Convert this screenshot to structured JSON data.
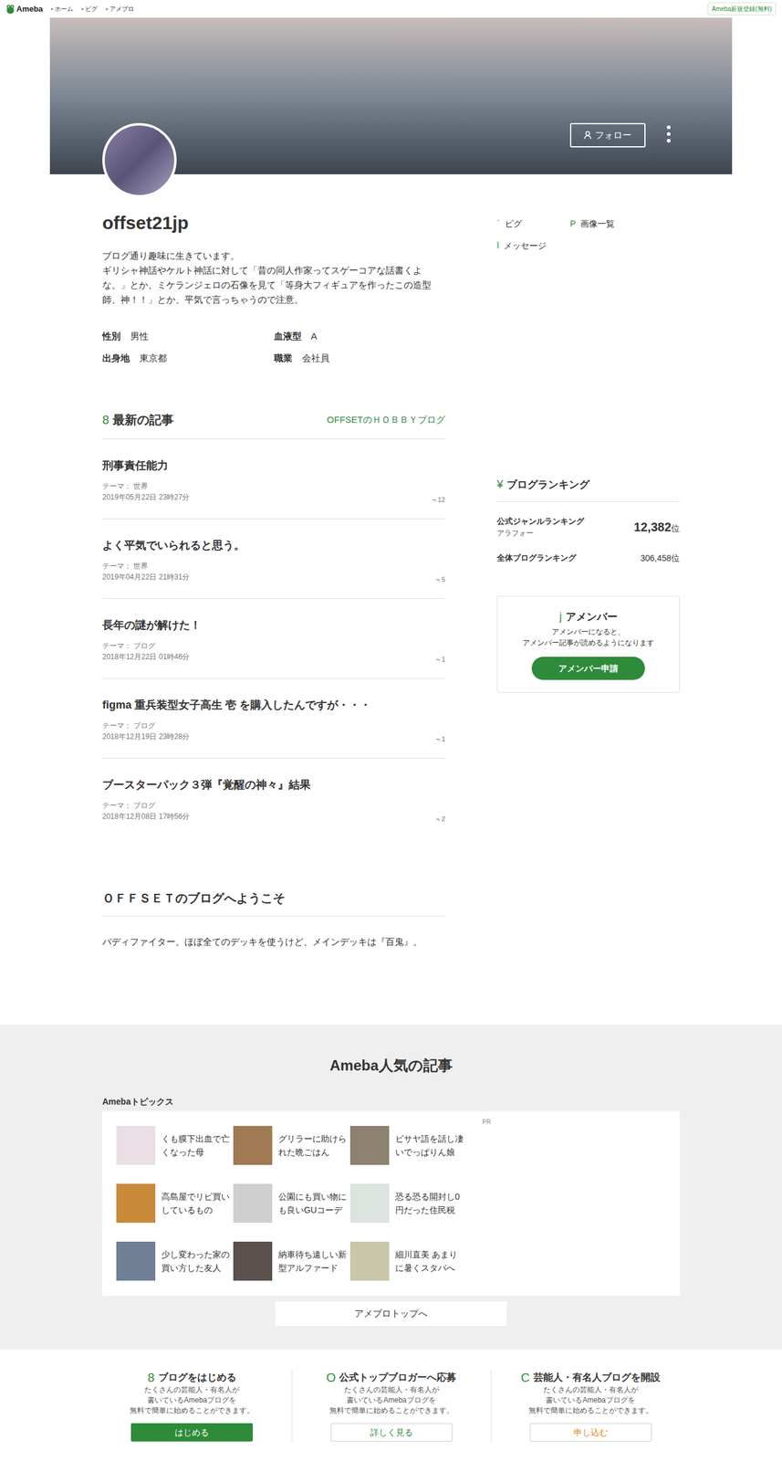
{
  "topbar": {
    "logo": "Ameba",
    "nav_marker": "▸",
    "nav": [
      "ホーム",
      "ピグ",
      "アメブロ"
    ],
    "register": "Ameba新規登録(無料)"
  },
  "header": {
    "follow": "フォロー"
  },
  "profile": {
    "name": "offset21jp",
    "bio": [
      "ブログ通り趣味に生きています。",
      "ギリシャ神話やケルト神話に対して「昔の同人作家ってスゲーコアな話書くよな。」とか、ミケランジェロの石像を見て「等身大フィギュアを作ったこの造型師、神！！」とか、平気で言っちゃうので注意。"
    ],
    "fields": [
      {
        "label": "性別",
        "value": "男性"
      },
      {
        "label": "血液型",
        "value": "A"
      },
      {
        "label": "出身地",
        "value": "東京都"
      },
      {
        "label": "職業",
        "value": "会社員"
      }
    ]
  },
  "latest": {
    "icon": "8",
    "title": "最新の記事",
    "blog_link": "OFFSETのＨＯＢＢＹブログ",
    "theme_label": "テーマ：",
    "comment_icon": "¬",
    "articles": [
      {
        "title": "刑事責任能力",
        "theme": "世界",
        "date": "2019年05月22日 23時27分",
        "comments": "12"
      },
      {
        "title": "よく平気でいられると思う。",
        "theme": "世界",
        "date": "2019年04月22日 21時31分",
        "comments": "5"
      },
      {
        "title": "長年の謎が解けた！",
        "theme": "ブログ",
        "date": "2018年12月22日 01時46分",
        "comments": "1"
      },
      {
        "title": "figma 重兵装型女子高生 壱 を購入したんですが・・・",
        "theme": "ブログ",
        "date": "2018年12月19日 23時28分",
        "comments": "1"
      },
      {
        "title": "ブースターパック３弾『覚醒の神々』結果",
        "theme": "ブログ",
        "date": "2018年12月08日 17時56分",
        "comments": "2"
      }
    ]
  },
  "welcome": {
    "title": "ＯＦＦＳＥＴのブログへようこそ",
    "text": "バディファイター。ほぼ全てのデッキを使うけど、メインデッキは『百鬼』。"
  },
  "side_menu": [
    {
      "icon": "`",
      "label": "ピグ"
    },
    {
      "icon": "P",
      "label": "画像一覧"
    },
    {
      "icon": "l",
      "label": "メッセージ"
    }
  ],
  "ranking": {
    "icon": "¥",
    "title": "ブログランキング",
    "rows": [
      {
        "label": "公式ジャンルランキング",
        "sub": "アラフォー",
        "value": "12,382",
        "unit": "位",
        "emphasis": true
      },
      {
        "label": "全体ブログランキング",
        "sub": "",
        "value": "306,458",
        "unit": "位",
        "emphasis": false
      }
    ]
  },
  "amember": {
    "icon": "j",
    "title": "アメンバー",
    "lines": [
      "アメンバーになると、",
      "アメンバー記事が読めるようになります"
    ],
    "button": "アメンバー申請"
  },
  "popular": {
    "title": "Ameba人気の記事",
    "topics_title": "Amebaトピックス",
    "pr": "PR",
    "topics": [
      "くも膜下出血で亡くなった母",
      "グリラーに助けられた晩ごはん",
      "ビサヤ語を話し凄いでっぱりん娘",
      "高島屋でリピ買いしているもの",
      "公園にも買い物にも良いGUコーデ",
      "恐る恐る開封し0円だった住民税",
      "少し変わった家の買い方した友人",
      "納車待ち遠しい新型アルファード",
      "細川直美 あまりに暑くスタバへ"
    ],
    "top_button": "アメブロトップへ"
  },
  "footer": [
    {
      "icon": "8",
      "title": "ブログをはじめる",
      "lines": [
        "たくさんの芸能人・有名人が",
        "書いているAmebaブログを",
        "無料で簡単に始めることができます。"
      ],
      "button": "はじめる",
      "kind": "filled"
    },
    {
      "icon": "O",
      "title": "公式トップブロガーへ応募",
      "lines": [
        "たくさんの芸能人・有名人が",
        "書いているAmebaブログを",
        "無料で簡単に始めることができます。"
      ],
      "button": "詳しく見る",
      "kind": "outline"
    },
    {
      "icon": "C",
      "title": "芸能人・有名人ブログを開設",
      "lines": [
        "たくさんの芸能人・有名人が",
        "書いているAmebaブログを",
        "無料で簡単に始めることができます。"
      ],
      "button": "申し込む",
      "kind": "accent"
    }
  ]
}
